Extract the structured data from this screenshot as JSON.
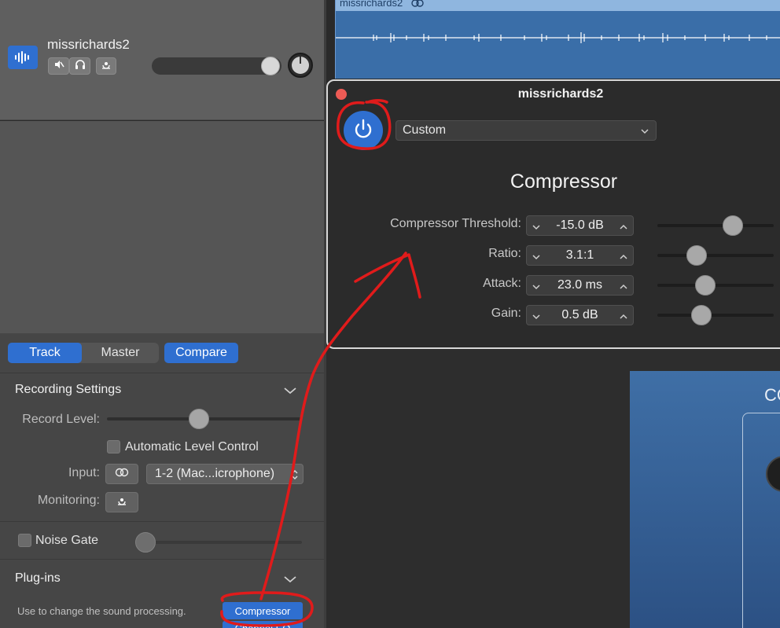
{
  "track": {
    "name": "missrichards2"
  },
  "region": {
    "title": "missrichards2"
  },
  "plugin_window": {
    "title": "missrichards2",
    "preset": "Custom",
    "heading": "Compressor",
    "params": [
      {
        "label": "Compressor Threshold:",
        "value": "-15.0 dB",
        "level": 0.65
      },
      {
        "label": "Ratio:",
        "value": "3.1:1",
        "level": 0.34
      },
      {
        "label": "Attack:",
        "value": "23.0 ms",
        "level": 0.41
      },
      {
        "label": "Gain:",
        "value": "0.5 dB",
        "level": 0.38
      }
    ]
  },
  "right_panel": {
    "partial_text": "CO"
  },
  "tabs": {
    "track": "Track",
    "master": "Master",
    "compare": "Compare"
  },
  "recording_settings": {
    "title": "Recording Settings",
    "record_level_label": "Record Level:",
    "record_level": 0.47,
    "auto_level_label": "Automatic Level Control",
    "input_label": "Input:",
    "input_value": "1-2  (Mac...icrophone)",
    "monitoring_label": "Monitoring:"
  },
  "noise_gate": {
    "label": "Noise Gate",
    "level": 0.0
  },
  "plugins": {
    "title": "Plug-ins",
    "description": "Use to change the sound processing.",
    "slot1": "Compressor",
    "slot2": "Channel EQ"
  },
  "colors": {
    "accent": "#2f6fd0",
    "annotation": "#e01b1b"
  }
}
